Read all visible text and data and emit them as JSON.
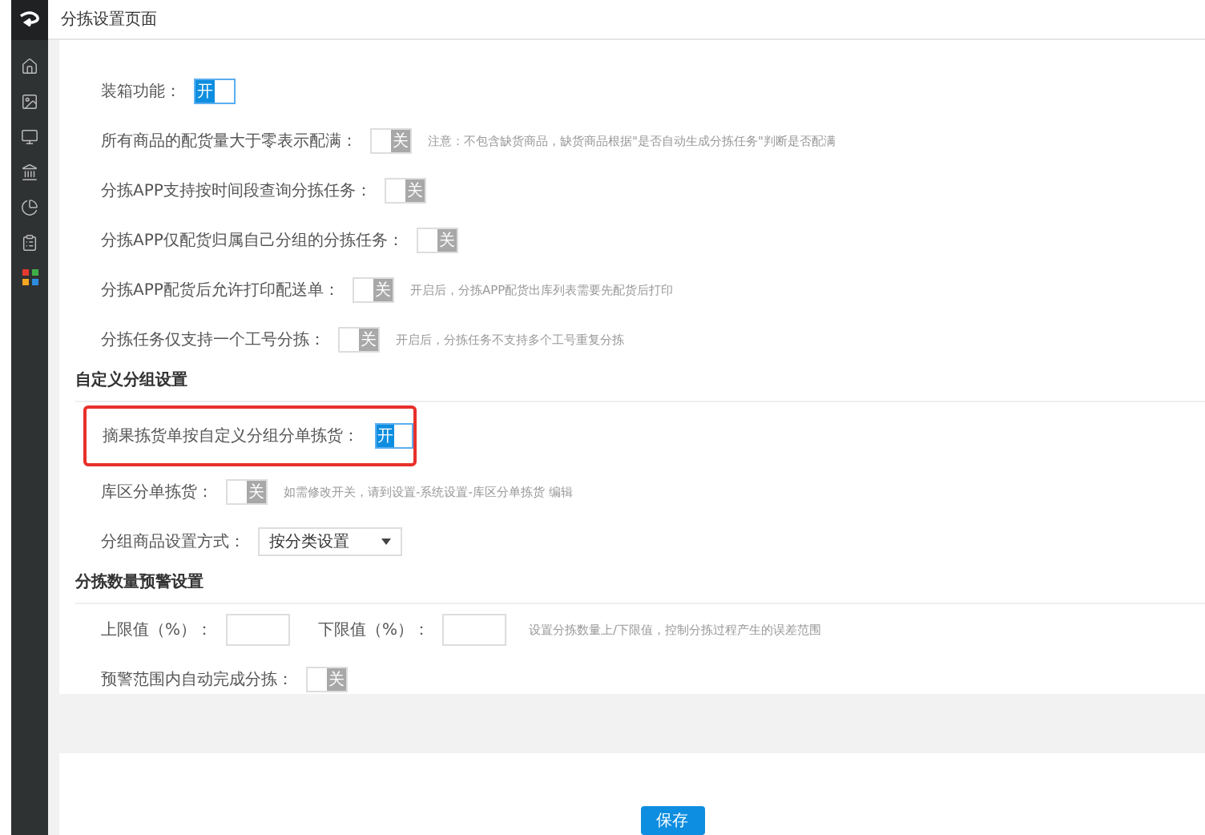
{
  "window": {
    "title": "分拣设置页面"
  },
  "sections": [
    {
      "rows": [
        {
          "kind": "toggle",
          "label": "装箱功能：",
          "on": true,
          "text": "开",
          "highlighted": false
        },
        {
          "kind": "toggle",
          "label": "所有商品的配货量大于零表示配满：",
          "on": false,
          "text": "关",
          "note": "注意：不包含缺货商品，缺货商品根据\"是否自动生成分拣任务\"判断是否配满",
          "highlighted": false
        },
        {
          "kind": "toggle",
          "label": "分拣APP支持按时间段查询分拣任务：",
          "on": false,
          "text": "关",
          "highlighted": false
        },
        {
          "kind": "toggle",
          "label": "分拣APP仅配货归属自己分组的分拣任务：",
          "on": false,
          "text": "关",
          "highlighted": false
        },
        {
          "kind": "toggle",
          "label": "分拣APP配货后允许打印配送单：",
          "on": false,
          "text": "关",
          "note": "开启后，分拣APP配货出库列表需要先配货后打印",
          "highlighted": false
        },
        {
          "kind": "toggle",
          "label": "分拣任务仅支持一个工号分拣：",
          "on": false,
          "text": "关",
          "note": "开启后，分拣任务不支持多个工号重复分拣",
          "highlighted": false
        }
      ]
    },
    {
      "title": "自定义分组设置",
      "rows": [
        {
          "kind": "toggle",
          "label": "摘果拣货单按自定义分组分单拣货：",
          "on": true,
          "text": "开",
          "highlighted": true
        },
        {
          "kind": "toggle",
          "label": "库区分单拣货：",
          "on": false,
          "text": "关",
          "note": "如需修改开关，请到设置-系统设置-库区分单拣货 编辑",
          "highlighted": false
        },
        {
          "kind": "select",
          "label": "分组商品设置方式：",
          "value": "按分类设置",
          "highlighted": false
        }
      ]
    },
    {
      "title": "分拣数量预警设置",
      "rows": [
        {
          "kind": "range",
          "label": "上限值（%）：",
          "label2": "下限值（%）：",
          "note": "设置分拣数量上/下限值，控制分拣过程产生的误差范围",
          "highlighted": false
        },
        {
          "kind": "toggle",
          "label": "预警范围内自动完成分拣：",
          "on": false,
          "text": "关",
          "highlighted": false
        }
      ]
    }
  ],
  "save_button": "保存"
}
